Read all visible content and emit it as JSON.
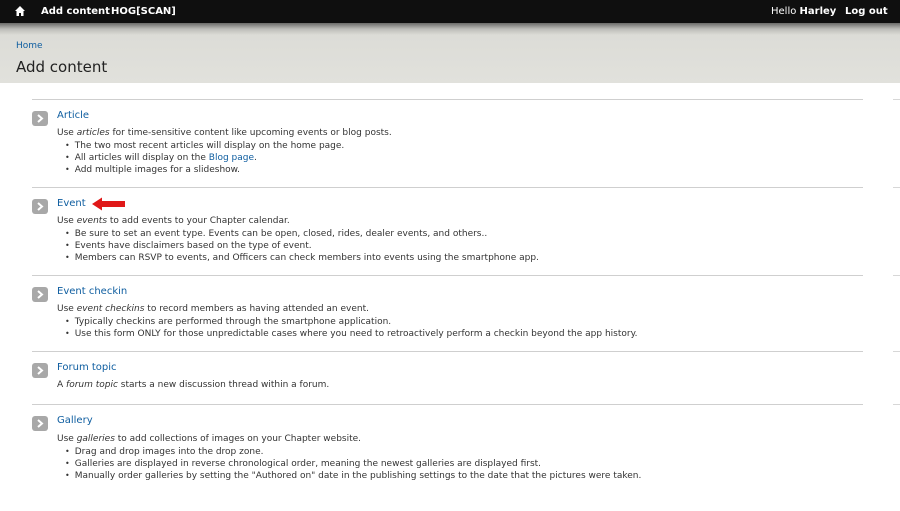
{
  "toolbar": {
    "home_icon": "home-icon",
    "add_content": "Add content",
    "site_name": "HOG[SCAN]",
    "hello_prefix": "Hello",
    "user_name": "Harley",
    "logout": "Log out"
  },
  "header": {
    "breadcrumb_home": "Home",
    "title": "Add content"
  },
  "entries": [
    {
      "title": "Article",
      "desc_prefix": "Use ",
      "desc_em": "articles",
      "desc_suffix": " for time-sensitive content like upcoming events or blog posts.",
      "bullets": [
        "The two most recent articles will display on the home page.",
        "All articles will display on the ",
        "Add multiple images for a slideshow."
      ],
      "bullet_link": "Blog page",
      "bullet_link_suffix": "."
    },
    {
      "title": "Event",
      "desc_prefix": "Use ",
      "desc_em": "events",
      "desc_suffix": " to add events to your Chapter calendar.",
      "bullets": [
        "Be sure to set an event type. Events can be open, closed, rides, dealer events, and others..",
        "Events have disclaimers based on the type of event.",
        "Members can RSVP to events, and Officers can check members into events using the smartphone app."
      ]
    },
    {
      "title": "Event checkin",
      "desc_prefix": "Use ",
      "desc_em": "event checkins",
      "desc_suffix": " to record members as having attended an event.",
      "bullets": [
        "Typically checkins are performed through the smartphone application.",
        "Use this form ONLY for those unpredictable cases where you need to retroactively perform a checkin beyond the app history."
      ]
    },
    {
      "title": "Forum topic",
      "desc_prefix": "A ",
      "desc_em": "forum topic",
      "desc_suffix": " starts a new discussion thread within a forum.",
      "bullets": []
    },
    {
      "title": "Gallery",
      "desc_prefix": "Use ",
      "desc_em": "galleries",
      "desc_suffix": " to add collections of images on your Chapter website.",
      "bullets": [
        "Drag and drop images into the drop zone.",
        "Galleries are displayed in reverse chronological order, meaning the newest galleries are displayed first.",
        "Manually order galleries by setting the \"Authored on\" date in the publishing settings to the date that the pictures were taken."
      ]
    }
  ],
  "icons": {
    "entry_arrow": "chevron-right-icon",
    "annotation": "red-arrow-icon"
  },
  "colors": {
    "link": "#0f5ea0",
    "toolbar_bg": "#0f0f0f",
    "header_bg": "#e1e1dc",
    "annotation": "#e01818"
  }
}
